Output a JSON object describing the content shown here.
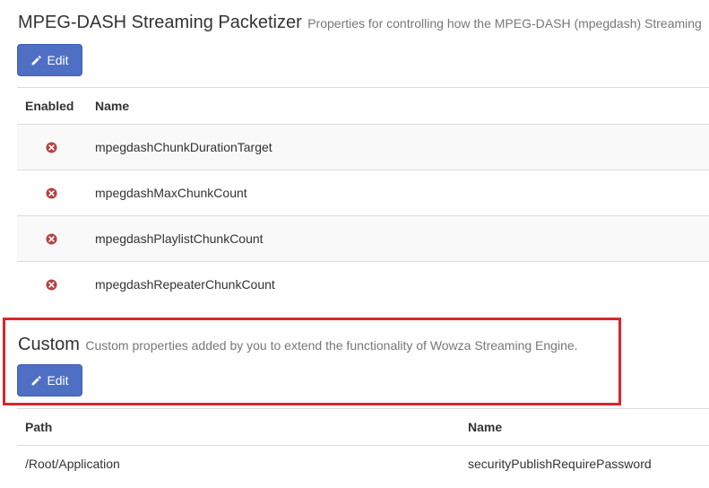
{
  "packetizer": {
    "title": "MPEG-DASH Streaming Packetizer",
    "description": "Properties for controlling how the MPEG-DASH (mpegdash) Streaming",
    "edit_label": "Edit",
    "columns": {
      "enabled": "Enabled",
      "name": "Name"
    },
    "rows": [
      {
        "enabled_icon": "disabled-x-icon",
        "name": "mpegdashChunkDurationTarget"
      },
      {
        "enabled_icon": "disabled-x-icon",
        "name": "mpegdashMaxChunkCount"
      },
      {
        "enabled_icon": "disabled-x-icon",
        "name": "mpegdashPlaylistChunkCount"
      },
      {
        "enabled_icon": "disabled-x-icon",
        "name": "mpegdashRepeaterChunkCount"
      }
    ]
  },
  "custom": {
    "title": "Custom",
    "description": "Custom properties added by you to extend the functionality of Wowza Streaming Engine.",
    "edit_label": "Edit",
    "columns": {
      "path": "Path",
      "name": "Name"
    },
    "rows": [
      {
        "path": "/Root/Application",
        "name": "securityPublishRequirePassword"
      }
    ]
  },
  "colors": {
    "button": "#4f6fc4",
    "disabled_icon": "#b74242",
    "highlight": "#d9262b",
    "stripe": "#f9f9f9"
  }
}
